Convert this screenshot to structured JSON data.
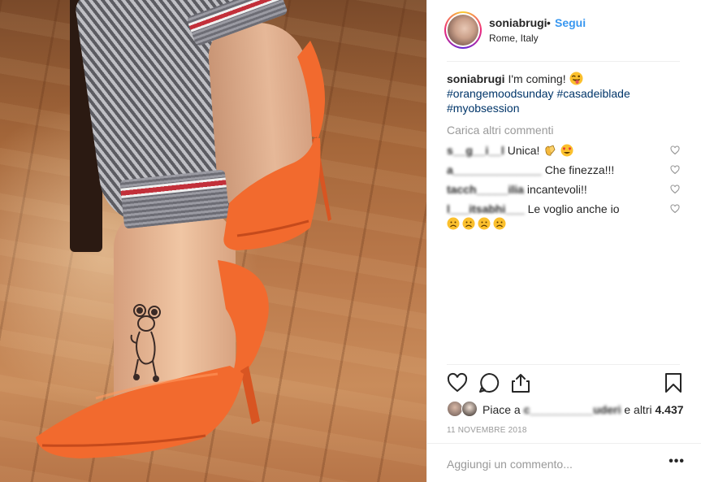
{
  "post": {
    "username": "soniabrugi",
    "separator": "•",
    "follow_label": "Segui",
    "location": "Rome, Italy"
  },
  "caption": {
    "username": "soniabrugi",
    "text": "I'm coming!",
    "emoji": "tongue-out-face",
    "hashtags": [
      "#orangemoodsunday",
      "#casadeiblade",
      "#myobsession"
    ]
  },
  "load_more_label": "Carica altri commenti",
  "comments": [
    {
      "username": "s__g__i__l",
      "text": "Unica!",
      "emojis": [
        "clapping-hands",
        "heart-eyes-face"
      ]
    },
    {
      "username": "a______________",
      "text": "Che finezza!!!",
      "emojis": []
    },
    {
      "username": "tacch_____ilia",
      "text": "incantevoli!!",
      "emojis": []
    },
    {
      "username": "l___itsabhi___",
      "text": "Le voglio anche io",
      "emojis": [
        "sad-face",
        "sad-face",
        "sad-face",
        "sad-face"
      ]
    }
  ],
  "likes": {
    "prefix": "Piace a",
    "blurred_user": "c__________uderi",
    "suffix": "e altri",
    "count": "4.437"
  },
  "date": "11 NOVEMBRE 2018",
  "add_comment_placeholder": "Aggiungi un commento...",
  "more_label": "•••",
  "colors": {
    "follow": "#3897f0",
    "hashtag": "#003569",
    "muted": "#999999",
    "shoe": "#f26a2e"
  }
}
